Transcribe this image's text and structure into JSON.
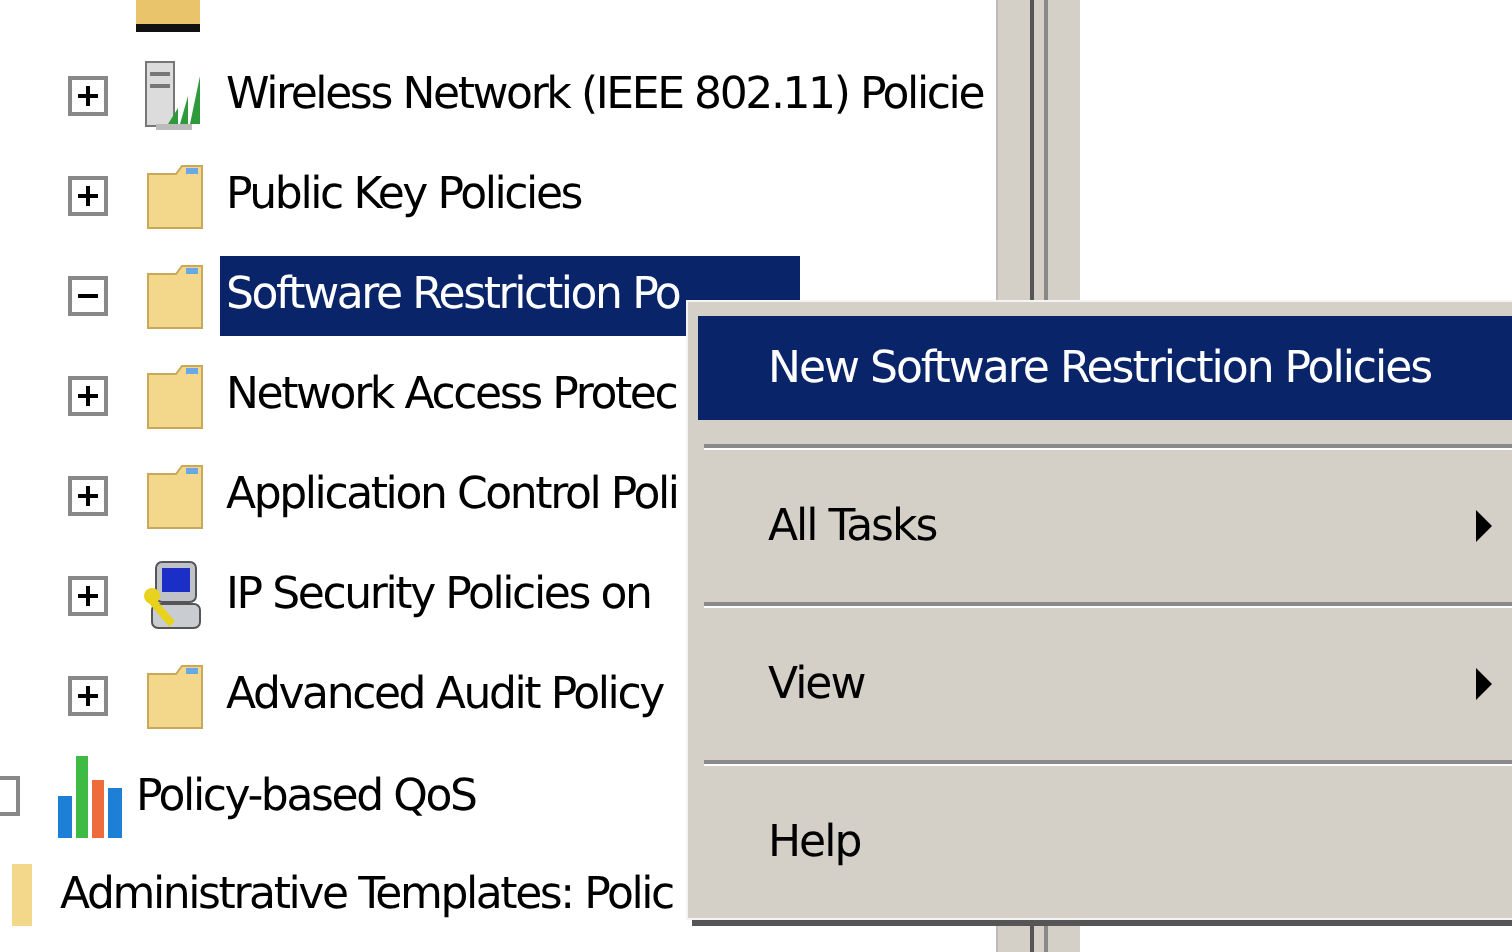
{
  "tree": {
    "nested_items": [
      {
        "label": "Wireless Network (IEEE 802.11) Policie",
        "kind": "wireless",
        "expanded": false,
        "selected": false
      },
      {
        "label": "Public Key Policies",
        "kind": "folder",
        "expanded": false,
        "selected": false
      },
      {
        "label": "Software Restriction Po",
        "kind": "folder",
        "expanded": true,
        "selected": true
      },
      {
        "label": "Network Access Protec",
        "kind": "folder",
        "expanded": false,
        "selected": false
      },
      {
        "label": "Application Control Poli",
        "kind": "folder",
        "expanded": false,
        "selected": false
      },
      {
        "label": "IP Security Policies on",
        "kind": "computer",
        "expanded": false,
        "selected": false
      },
      {
        "label": "Advanced Audit Policy",
        "kind": "folder",
        "expanded": false,
        "selected": false
      }
    ],
    "items": [
      {
        "label": "Policy-based QoS",
        "kind": "chart"
      },
      {
        "label": "Administrative Templates: Polic",
        "kind": "folder"
      }
    ]
  },
  "context_menu": {
    "items": [
      {
        "label": "New Software Restriction Policies",
        "selected": true,
        "submenu": false
      },
      {
        "label": "All Tasks",
        "selected": false,
        "submenu": true
      },
      {
        "label": "View",
        "selected": false,
        "submenu": true
      },
      {
        "label": "Help",
        "selected": false,
        "submenu": false
      }
    ]
  }
}
